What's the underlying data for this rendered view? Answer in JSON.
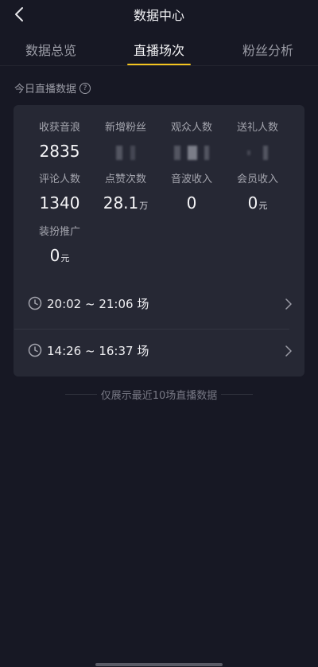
{
  "header": {
    "title": "数据中心"
  },
  "tabs": [
    {
      "label": "数据总览",
      "active": false
    },
    {
      "label": "直播场次",
      "active": true
    },
    {
      "label": "粉丝分析",
      "active": false
    }
  ],
  "section": {
    "label": "今日直播数据",
    "help_icon": "question-circle-icon"
  },
  "metrics": {
    "income_label": "收获音浪",
    "income_value": "2835",
    "new_fans_label": "新增粉丝",
    "viewers_label": "观众人数",
    "gifters_label": "送礼人数",
    "comments_label": "评论人数",
    "comments_value": "1340",
    "likes_label": "点赞次数",
    "likes_value": "28.1",
    "likes_unit": "万",
    "sound_income_label": "音波收入",
    "sound_income_value": "0",
    "member_income_label": "会员收入",
    "member_income_value": "0",
    "member_income_unit": "元",
    "decor_label": "装扮推广",
    "decor_value": "0",
    "decor_unit": "元"
  },
  "sessions": [
    {
      "label": "20:02 ~ 21:06 场"
    },
    {
      "label": "14:26 ~ 16:37 场"
    }
  ],
  "footnote": "仅展示最近10场直播数据",
  "colors": {
    "background": "#171824",
    "card": "#262834",
    "accent": "#f4c51f"
  }
}
